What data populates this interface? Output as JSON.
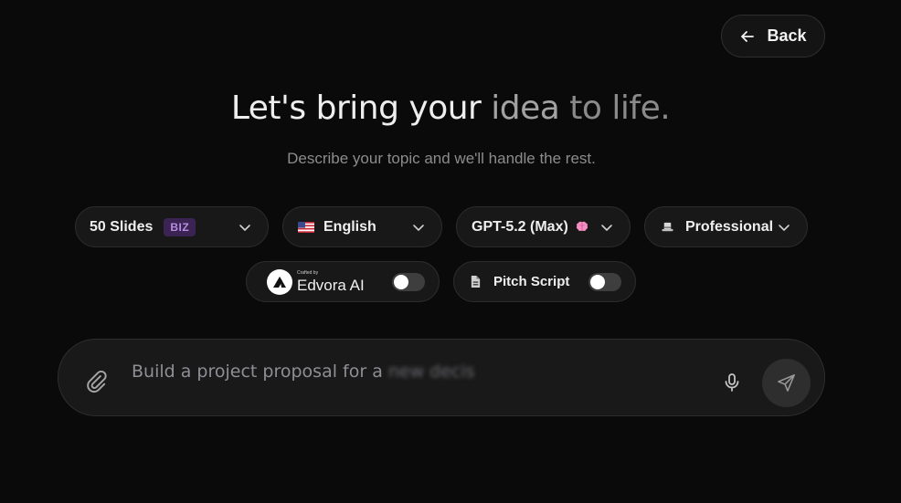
{
  "header": {
    "back_label": "Back"
  },
  "hero": {
    "headline_part1": "Let's bring your ",
    "headline_part2": "idea",
    "headline_part3": " to life.",
    "subtitle": "Describe your topic and we'll handle the rest."
  },
  "options": {
    "slides": {
      "label": "50 Slides",
      "badge": "BIZ"
    },
    "language": {
      "label": "English",
      "flag": "us-flag-icon"
    },
    "model": {
      "label": "GPT-5.2 (Max)",
      "icon": "brain-icon"
    },
    "tone": {
      "label": "Professional",
      "icon": "top-hat-icon"
    },
    "branding": {
      "small_label": "Crafted by",
      "brand_name": "Edvora AI",
      "enabled": false
    },
    "pitch_script": {
      "label": "Pitch Script",
      "enabled": false
    }
  },
  "prompt": {
    "text_visible": "Build a project proposal for a ",
    "text_faded": "new decis"
  },
  "colors": {
    "background": "#0a0a0a",
    "pill_bg": "#181818",
    "badge_bg": "#3b2353",
    "badge_text": "#b78ee0",
    "brain": "#f58fc2"
  }
}
